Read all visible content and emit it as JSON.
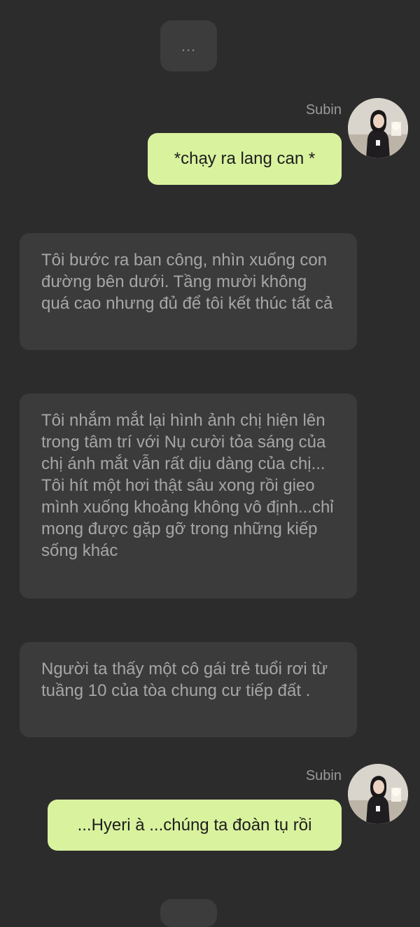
{
  "typing_indicator": {
    "text": "..."
  },
  "messages": [
    {
      "role": "user",
      "sender": "Subin",
      "text": "*chạy ra lang can *"
    },
    {
      "role": "narration",
      "text": "Tôi bước ra ban công, nhìn xuống con đường bên dưới. Tầng mười không quá cao nhưng đủ để tôi kết thúc tất cả"
    },
    {
      "role": "narration",
      "text": "Tôi nhắm mắt lại hình ảnh chị hiện lên trong tâm trí với Nụ cười tỏa sáng của chị ánh mắt vẫn rất dịu dàng của chị... Tôi hít một hơi thật sâu xong rồi gieo mình xuống khoảng không vô định...chỉ mong được gặp gỡ trong những kiếp sống khác"
    },
    {
      "role": "narration",
      "text": "Người ta thấy một cô gái trẻ tuổi rơi từ tuầng 10 của tòa chung cư tiếp đất ."
    },
    {
      "role": "user",
      "sender": "Subin",
      "text": "...Hyeri à ...chúng ta đoàn tụ rồi"
    }
  ],
  "colors": {
    "background": "#2c2c2c",
    "user_bubble": "#d9f29e",
    "narration_bubble": "#3b3b3b",
    "narration_text": "#a6a6a6"
  }
}
